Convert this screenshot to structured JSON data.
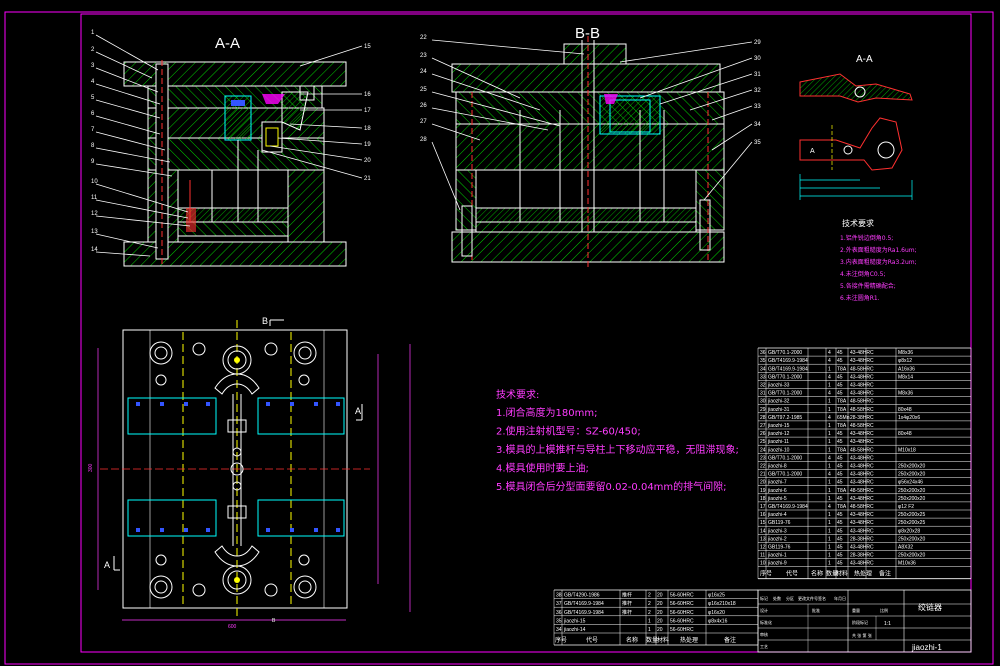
{
  "drawing": {
    "section_aa": "A-A",
    "section_bb": "B-B",
    "detail_view_label": "A-A",
    "section_mark_a": "A",
    "section_mark_b": "B",
    "leaders_aa_left": [
      "1",
      "2",
      "3",
      "4",
      "5",
      "6",
      "7",
      "8",
      "9",
      "10",
      "11",
      "12",
      "13",
      "14"
    ],
    "leaders_aa_right": [
      "15",
      "16",
      "17",
      "18",
      "19",
      "20",
      "21"
    ],
    "leaders_bb_left": [
      "22",
      "23",
      "24",
      "25",
      "26",
      "27",
      "28"
    ],
    "leaders_bb_right": [
      "29",
      "30",
      "31",
      "32",
      "33",
      "34",
      "35"
    ],
    "width_dim": "600",
    "height_dim": "300"
  },
  "notes_main": {
    "title": "技术要求:",
    "lines": [
      "1.闭合高度为180mm;",
      "2.使用注射机型号：SZ-60/450;",
      "3.模具的上模推杆与导柱上下移动应平稳，无阻滞现象;",
      "4.模具使用时要上油;",
      "5.模具闭合后分型面要留0.02-0.04mm的排气间隙;"
    ]
  },
  "notes_small": {
    "title": "技术要求",
    "lines": [
      "1.铝件锐边倒角0.5;",
      "2.外表面粗糙度为Ra1.6um;",
      "3.内表面粗糙度为Ra3.2um;",
      "4.未注倒角C0.5;",
      "5.各接件需精确配合;",
      "6.未注圆角R1."
    ]
  },
  "bom_right": {
    "rows": [
      [
        "36",
        "GB/T70.1-2000",
        "",
        "4",
        "45",
        "43-48HRC",
        "M8x36"
      ],
      [
        "35",
        "GB/T4169.9-1984",
        "",
        "4",
        "45",
        "43-48HRC",
        "φ8x12"
      ],
      [
        "34",
        "GB/T4169.9-1984",
        "",
        "1",
        "T8A",
        "48-58HRC",
        "A16x36"
      ],
      [
        "33",
        "GB/T70.1-2000",
        "",
        "4",
        "45",
        "43-48HRC",
        "M8x14"
      ],
      [
        "32",
        "jiaozhi-33",
        "",
        "1",
        "45",
        "43-48HRC",
        ""
      ],
      [
        "31",
        "GB/T70.1-2000",
        "",
        "4",
        "45",
        "43-48HRC",
        "M8x36"
      ],
      [
        "30",
        "jiaozhi-32",
        "",
        "1",
        "T8A",
        "48-58HRC",
        ""
      ],
      [
        "29",
        "jiaozhi-31",
        "",
        "1",
        "T8A",
        "48-58HRC",
        "80x48"
      ],
      [
        "28",
        "GB/T97.2-1985",
        "",
        "4",
        "65Mn",
        "28-38HRC",
        "1x4φ20x6"
      ],
      [
        "27",
        "jiaozhi-15",
        "",
        "1",
        "T8A",
        "48-58HRC",
        ""
      ],
      [
        "26",
        "jiaozhi-12",
        "",
        "1",
        "45",
        "43-48HRC",
        "80x48"
      ],
      [
        "25",
        "jiaozhi-11",
        "",
        "1",
        "45",
        "43-48HRC",
        ""
      ],
      [
        "24",
        "jiaozhi-10",
        "",
        "1",
        "T8A",
        "48-58HRC",
        "M10x18"
      ],
      [
        "23",
        "GB/T70.1-2000",
        "",
        "4",
        "45",
        "43-48HRC",
        ""
      ],
      [
        "22",
        "jiaozhi-8",
        "",
        "1",
        "45",
        "43-48HRC",
        "250x200x20"
      ],
      [
        "21",
        "GB/T70.1-2000",
        "",
        "4",
        "45",
        "43-48HRC",
        "250x200x20"
      ],
      [
        "20",
        "jiaozhi-7",
        "",
        "1",
        "45",
        "43-48HRC",
        "φ56x24x46"
      ],
      [
        "19",
        "jiaozhi-6",
        "",
        "1",
        "T8A",
        "48-58HRC",
        "250x200x20"
      ],
      [
        "18",
        "jiaozhi-5",
        "",
        "1",
        "45",
        "43-48HRC",
        "250x200x20"
      ],
      [
        "17",
        "GB/T4169.9-1984",
        "",
        "4",
        "T8A",
        "48-58HRC",
        "φ12 F2"
      ],
      [
        "16",
        "jiaozhi-4",
        "",
        "1",
        "45",
        "43-48HRC",
        "250x200x25"
      ],
      [
        "15",
        "GB119-76",
        "",
        "1",
        "45",
        "43-48HRC",
        "250x200x25"
      ],
      [
        "14",
        "jiaozhi-3",
        "",
        "1",
        "45",
        "43-48HRC",
        "φ8x20x28"
      ],
      [
        "13",
        "jiaozhi-2",
        "",
        "1",
        "45",
        "28-38HRC",
        "250x200x20"
      ],
      [
        "12",
        "GB119-76",
        "",
        "1",
        "45",
        "43-48HRC",
        "A8X32"
      ],
      [
        "11",
        "jiaozhi-1",
        "",
        "1",
        "45",
        "28-38HRC",
        "250x200x20"
      ],
      [
        "10",
        "jiaozhi-9",
        "",
        "1",
        "45",
        "43-48HRC",
        "M10x36"
      ]
    ],
    "header": [
      "序号",
      "代号",
      "名称",
      "数量",
      "材料",
      "热处理",
      "备注"
    ]
  },
  "bom_bottom": {
    "rows": [
      [
        "38",
        "GB/T4290-1986",
        "推杆",
        "2",
        "20",
        "56-60HRC",
        "φ16x25"
      ],
      [
        "37",
        "GB/T4169.9-1984",
        "推杆",
        "2",
        "20",
        "56-60HRC",
        "φ16x210x18"
      ],
      [
        "36",
        "GB/T4169.9-1984",
        "推杆",
        "2",
        "20",
        "56-60HRC",
        "φ16x20"
      ],
      [
        "35",
        "jiaozhi-15",
        "",
        "1",
        "20",
        "56-60HRC",
        "φ8x4x16"
      ],
      [
        "34",
        "jiaozhi-14",
        "",
        "1",
        "20",
        "56-60HRC",
        ""
      ]
    ],
    "header": [
      "序号",
      "代号",
      "名称",
      "数量",
      "材料",
      "热处理",
      "备注"
    ]
  },
  "title_block": {
    "drawing_name": "绞链器",
    "drawing_no": "jiaozhi-1",
    "scale": "1:1",
    "sheet": "共 张 第 张",
    "cells": [
      "标记",
      "处数",
      "分区",
      "更改文件号",
      "签名",
      "年月日",
      "设计",
      "标准化",
      "审核",
      "工艺",
      "批准",
      "阶段标记",
      "重量",
      "比例"
    ]
  },
  "colors": {
    "frame": "#ff00ff",
    "outline": "#ffffff",
    "hatch": "#00ff00",
    "center": "#ffff00",
    "dim": "#00ffff",
    "red": "#ff3030",
    "blue": "#3355ff",
    "note": "#ff3cff",
    "grid_text": "#ffffff"
  }
}
